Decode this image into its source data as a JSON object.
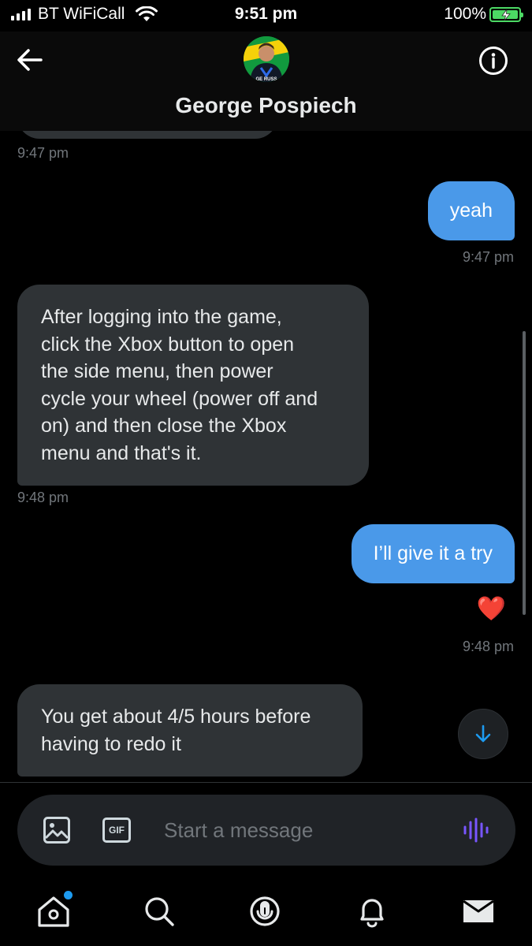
{
  "status_bar": {
    "carrier": "BT WiFiCall",
    "time": "9:51 pm",
    "battery": "100%",
    "battery_level": 1.0
  },
  "header": {
    "contact_name": "George Pospiech",
    "avatar_caption": "GE RUSS"
  },
  "messages": [
    {
      "direction": "incoming",
      "text": "",
      "time": "9:47 pm"
    },
    {
      "direction": "outgoing",
      "text": "yeah",
      "time": "9:47 pm"
    },
    {
      "direction": "incoming",
      "lines": [
        "After logging into the game,",
        "click the Xbox button to open",
        "the side menu, then power",
        "cycle your wheel (power off and",
        "on) and then close the Xbox",
        "menu and that's it."
      ],
      "time": "9:48 pm"
    },
    {
      "direction": "outgoing",
      "text": "I’ll give it a try",
      "reaction": "❤️",
      "time": "9:48 pm"
    },
    {
      "direction": "incoming",
      "lines": [
        "You get about 4/5 hours before",
        "having to redo it"
      ]
    }
  ],
  "composer": {
    "placeholder": "Start a message",
    "gif_label": "GIF"
  },
  "nav": {
    "items": [
      "home-icon",
      "search-icon",
      "spaces-icon",
      "notifications-icon",
      "messages-icon"
    ]
  },
  "colors": {
    "accent": "#1d9bf0",
    "outgoing_bubble": "#4a99e9",
    "incoming_bubble": "#2f3336",
    "battery": "#4cd964",
    "voice": "#7856ff"
  }
}
